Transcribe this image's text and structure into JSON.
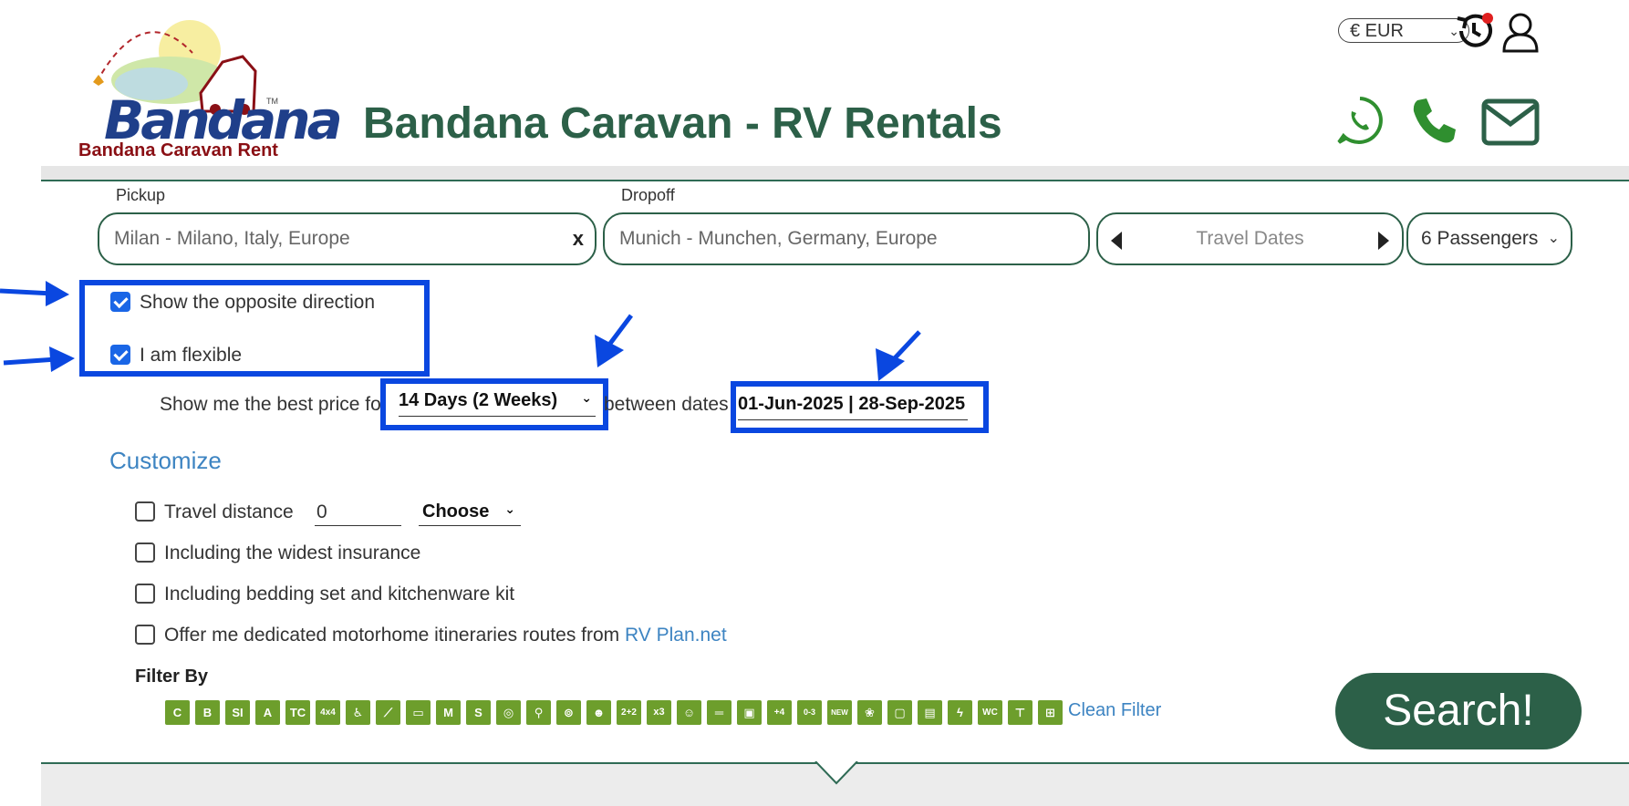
{
  "header": {
    "logo_word": "Bandana",
    "logo_tm": "TM",
    "logo_tagline": "Bandana Caravan Rent",
    "site_title": "Bandana Caravan - RV Rentals",
    "currency": "€ EUR",
    "icons": [
      "history-icon",
      "user-icon",
      "whatsapp-icon",
      "phone-icon",
      "mail-icon"
    ]
  },
  "search": {
    "pickup_label": "Pickup",
    "pickup_value": "Milan - Milano, Italy, Europe",
    "pickup_clear": "x",
    "dropoff_label": "Dropoff",
    "dropoff_value": "Munich - Munchen, Germany, Europe",
    "travel_dates_placeholder": "Travel Dates",
    "passengers": "6 Passengers"
  },
  "options": {
    "opposite_direction": {
      "label": "Show the opposite direction",
      "checked": true
    },
    "flexible": {
      "label": "I am flexible",
      "checked": true
    },
    "best_price_prefix": "Show me the best price for",
    "duration": "14 Days (2 Weeks)",
    "between_dates_label": "between dates",
    "date_range": "01-Jun-2025 | 28-Sep-2025"
  },
  "customize": {
    "title": "Customize",
    "travel_distance_label": "Travel distance",
    "travel_distance_value": "0",
    "distance_unit": "Choose",
    "insurance_label": "Including the widest insurance",
    "bedding_label": "Including bedding set and kitchenware kit",
    "itineraries_label": "Offer me dedicated motorhome itineraries routes from ",
    "itineraries_link": "RV Plan.net"
  },
  "filter": {
    "title": "Filter By",
    "icons": [
      "C",
      "B",
      "SI",
      "A",
      "TC",
      "4x4",
      "",
      "",
      "",
      "M",
      "S",
      "",
      "",
      "",
      "",
      "2+2",
      "x3",
      "",
      "",
      "",
      "+4",
      "0-3",
      "NEW",
      "",
      "",
      "",
      "",
      "WC",
      "",
      ""
    ],
    "clean_label": "Clean Filter"
  },
  "search_button": "Search!",
  "colors": {
    "brand_green": "#2c6048",
    "annotation_blue": "#0a47e0",
    "filter_green": "#6d9e2c",
    "link_blue": "#3d84c2",
    "logo_red": "#8a0f14"
  }
}
